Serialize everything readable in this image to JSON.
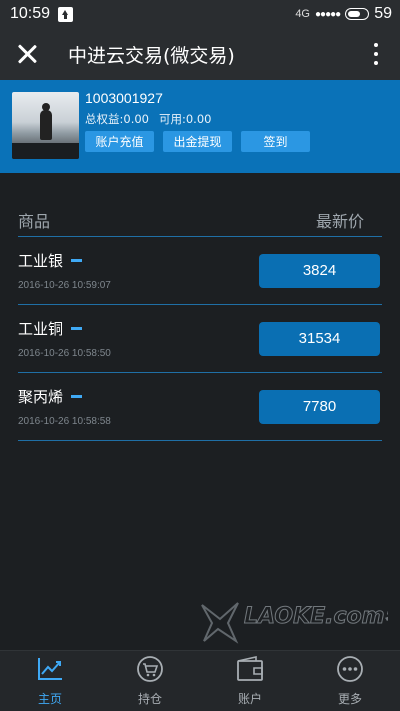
{
  "status_bar": {
    "time": "10:59",
    "network": "4G",
    "signal": "●●●●●",
    "battery": "59"
  },
  "title_bar": {
    "title": "中进云交易(微交易)"
  },
  "account": {
    "id": "1003001927",
    "equity_label": "总权益:",
    "equity_value": "0.00",
    "available_label": "可用:",
    "available_value": "0.00",
    "buttons": [
      "账户充值",
      "出金提现",
      "签到"
    ]
  },
  "quotes": {
    "header_product": "商品",
    "header_price": "最新价",
    "rows": [
      {
        "name": "工业银",
        "time": "2016-10-26 10:59:07",
        "price": "3824"
      },
      {
        "name": "工业铜",
        "time": "2016-10-26 10:58:50",
        "price": "31534"
      },
      {
        "name": "聚丙烯",
        "time": "2016-10-26 10:58:58",
        "price": "7780"
      }
    ]
  },
  "watermark": "LAOKE.com老客",
  "bottom_nav": {
    "items": [
      {
        "label": "主页",
        "icon": "chart-icon",
        "active": true
      },
      {
        "label": "持仓",
        "icon": "cart-icon",
        "active": false
      },
      {
        "label": "账户",
        "icon": "wallet-icon",
        "active": false
      },
      {
        "label": "更多",
        "icon": "more-circle-icon",
        "active": false
      }
    ]
  },
  "colors": {
    "accent": "#0a72b8",
    "active_nav": "#3fa9f5",
    "background": "#1c1f22"
  }
}
